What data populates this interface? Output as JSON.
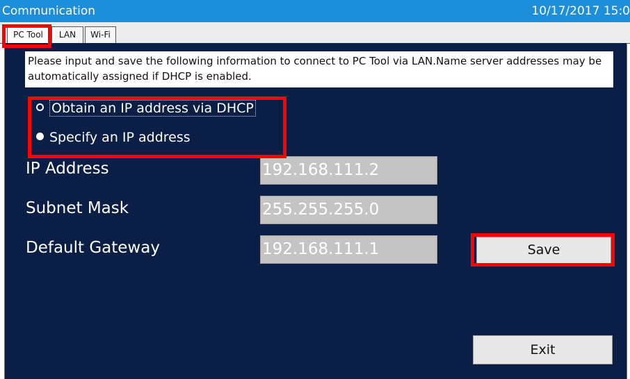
{
  "window": {
    "title": "Communication",
    "datetime": "10/17/2017 15:0"
  },
  "tabs": [
    {
      "label": "PC Tool",
      "active": true
    },
    {
      "label": "LAN",
      "active": false
    },
    {
      "label": "Wi-Fi",
      "active": false
    }
  ],
  "info_text": "Please input and save the following information to connect to PC Tool via LAN.Name server addresses may be automatically assigned if DHCP is enabled.",
  "radios": [
    {
      "label": "Obtain an IP address via DHCP",
      "selected": false
    },
    {
      "label": "Specify an IP address",
      "selected": true
    }
  ],
  "fields": [
    {
      "label": "IP Address",
      "value": "192.168.111.2"
    },
    {
      "label": "Subnet Mask",
      "value": "255.255.255.0"
    },
    {
      "label": "Default Gateway",
      "value": "192.168.111.1"
    }
  ],
  "buttons": {
    "save": "Save",
    "exit": "Exit"
  },
  "colors": {
    "titlebar": "#1d8fda",
    "panel": "#0b1e45",
    "highlight": "#ff0000"
  }
}
